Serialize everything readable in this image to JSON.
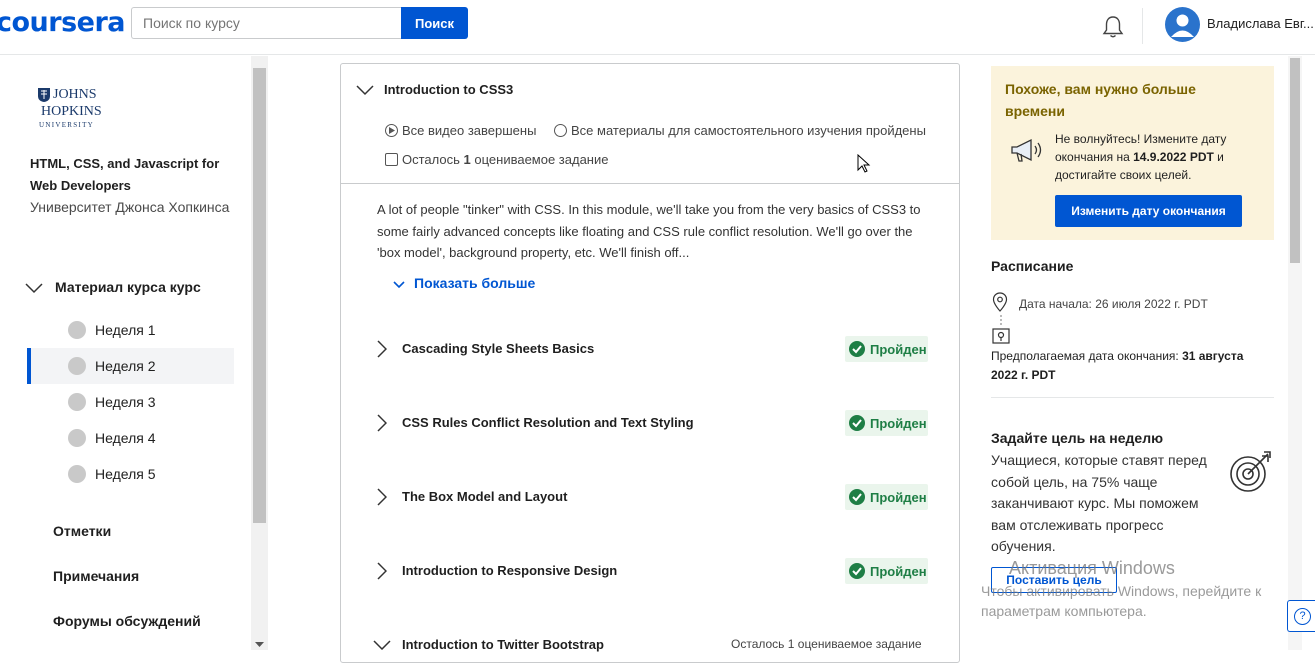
{
  "header": {
    "logo": "coursera",
    "search_placeholder": "Поиск по курсу",
    "search_button": "Поиск",
    "user_name": "Владислава Евг..."
  },
  "sidebar": {
    "university_logo": [
      "JOHNS",
      "HOPKINS",
      "UNIVERSITY"
    ],
    "course_title": "HTML, CSS, and Javascript for Web Developers",
    "university": "Университет Джонса Хопкинса",
    "material_label": "Материал курса курс",
    "weeks": [
      "Неделя 1",
      "Неделя 2",
      "Неделя 3",
      "Неделя 4",
      "Неделя 5"
    ],
    "active_week": "Неделя 2",
    "links": [
      "Отметки",
      "Примечания",
      "Форумы обсуждений"
    ]
  },
  "module": {
    "title": "Introduction to CSS3",
    "meta_videos": "Все видео завершены",
    "meta_materials": "Все материалы для самостоятельного изучения пройдены",
    "meta_remaining_prefix": "Осталось",
    "meta_remaining_count": "1",
    "meta_remaining_suffix": "оцениваемое задание",
    "description": "A lot of people \"tinker\" with CSS. In this module, we'll take you from the very basics of CSS3 to some fairly advanced concepts like floating and CSS rule conflict resolution. We'll go over the 'box model', background property, etc. We'll finish off...",
    "show_more": "Показать больше",
    "lessons": [
      {
        "title": "Cascading Style Sheets Basics",
        "status": "Пройден"
      },
      {
        "title": "CSS Rules Conflict Resolution and Text Styling",
        "status": "Пройден"
      },
      {
        "title": "The Box Model and Layout",
        "status": "Пройден"
      },
      {
        "title": "Introduction to Responsive Design",
        "status": "Пройден"
      },
      {
        "title": "Introduction to Twitter Bootstrap",
        "status": "Осталось 1 оцениваемое задание"
      }
    ]
  },
  "right_panel": {
    "deadline_title": "Похоже, вам нужно больше времени",
    "deadline_text_1": "Не волнуйтесь! Измените дату окончания на ",
    "deadline_date": "14.9.2022 PDT",
    "deadline_text_2": " и достигайте своих целей.",
    "change_date_button": "Изменить дату окончания",
    "schedule_title": "Расписание",
    "start_date": "Дата начала: 26 июля 2022 г. PDT",
    "end_date_label": "Предполагаемая дата окончания: ",
    "end_date_value": "31 августа 2022 г. PDT",
    "goal_title": "Задайте цель на неделю",
    "goal_text": "Учащиеся, которые ставят перед собой цель, на 75% чаще заканчивают курс. Мы поможем вам отслеживать прогресс обучения.",
    "set_goal_button": "Поставить цель"
  },
  "watermark": {
    "title": "Активация Windows",
    "text": "Чтобы активировать Windows, перейдите к параметрам компьютера."
  },
  "help_label": "?",
  "colors": {
    "accent": "#0056d2",
    "passed": "#1e7e45",
    "deadline_bg": "#fbf3dc"
  }
}
